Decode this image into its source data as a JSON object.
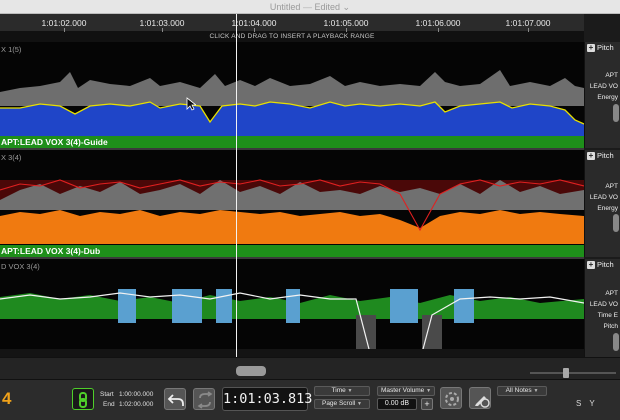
{
  "window": {
    "title": "Untitled",
    "separator": "—",
    "state": "Edited",
    "chevron": "⌄"
  },
  "ruler": {
    "ticks": [
      "1:01:02.000",
      "1:01:03.000",
      "1:01:04.000",
      "1:01:05.000",
      "1:01:06.000",
      "1:01:07.000"
    ],
    "hint": "CLICK AND DRAG TO INSERT A PLAYBACK RANGE"
  },
  "tracks": [
    {
      "name": "X 1(5)",
      "clip_label": "APT:LEAD VOX 3(4)-Guide",
      "panel": {
        "title": "Pitch",
        "lines": [
          "APT",
          "LEAD VO",
          "Energy"
        ]
      }
    },
    {
      "name": "X 3(4)",
      "clip_label": "APT:LEAD VOX 3(4)-Dub",
      "panel": {
        "title": "Pitch",
        "lines": [
          "APT",
          "LEAD VO",
          "Energy"
        ]
      }
    },
    {
      "name": "D VOX 3(4)",
      "clip_label": "",
      "panel": {
        "title": "Pitch",
        "lines": [
          "APT",
          "LEAD VO",
          "Time E",
          "Pitch"
        ]
      }
    }
  ],
  "transport": {
    "logo_digit": "4",
    "start_label": "Start",
    "start_value": "1:00:00.000",
    "end_label": "End",
    "end_value": "1:02:00.000",
    "timecode": "1:01:03.813",
    "view_mode": "Time",
    "scroll_mode": "Page Scroll",
    "master_volume_label": "Master Volume",
    "master_volume_value": "0.00 dB",
    "plus": "+",
    "notes_filter": "All Notes",
    "brand": "S Y"
  },
  "colors": {
    "guide_fill": "#1f45c8",
    "guide_line": "#e8e000",
    "dub_fill": "#f07a10",
    "pitch_red": "#e02020",
    "clip_green": "#1e8f1a",
    "pitch_green": "#1f8a1f",
    "time_blue": "#5aa0d0",
    "accent_orange": "#f0a21a"
  },
  "icons": {
    "sync": "link-icon",
    "undo": "undo-icon",
    "loop": "loop-icon",
    "cycle": "cycle-icon",
    "edit": "pen-icon"
  }
}
